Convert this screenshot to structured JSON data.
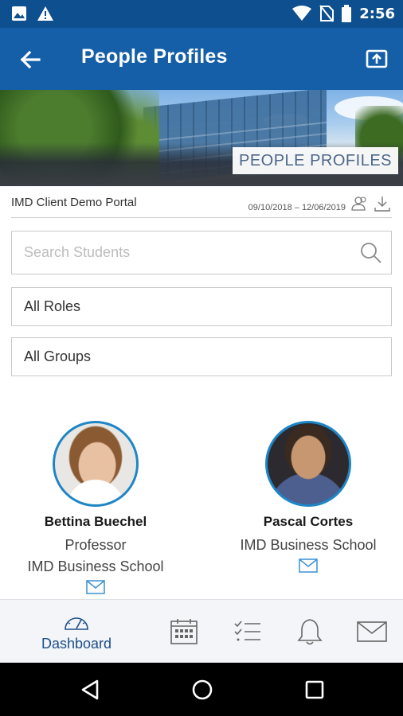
{
  "status_bar": {
    "time": "2:56",
    "icons": [
      "image-icon",
      "warning-icon",
      "wifi-icon",
      "no-sim-icon",
      "battery-icon"
    ]
  },
  "app_bar": {
    "title": "People Profiles",
    "back_icon": "arrow-left-icon",
    "share_icon": "share-icon"
  },
  "banner": {
    "label": "PEOPLE PROFILES"
  },
  "portal": {
    "name": "IMD Client Demo Portal",
    "dates": "09/10/2018 – 12/06/2019"
  },
  "search": {
    "placeholder": "Search Students"
  },
  "filters": {
    "roles": "All Roles",
    "groups": "All Groups"
  },
  "people": [
    {
      "name": "Bettina Buechel",
      "role": "Professor",
      "org": "IMD Business School"
    },
    {
      "name": "Pascal Cortes",
      "org": "IMD Business School"
    }
  ],
  "bottom_nav": {
    "dashboard": "Dashboard"
  },
  "colors": {
    "status_bar": "#0d4f8f",
    "app_bar": "#155fa8",
    "accent": "#1f86c6",
    "nav_label": "#1d4f8a"
  }
}
